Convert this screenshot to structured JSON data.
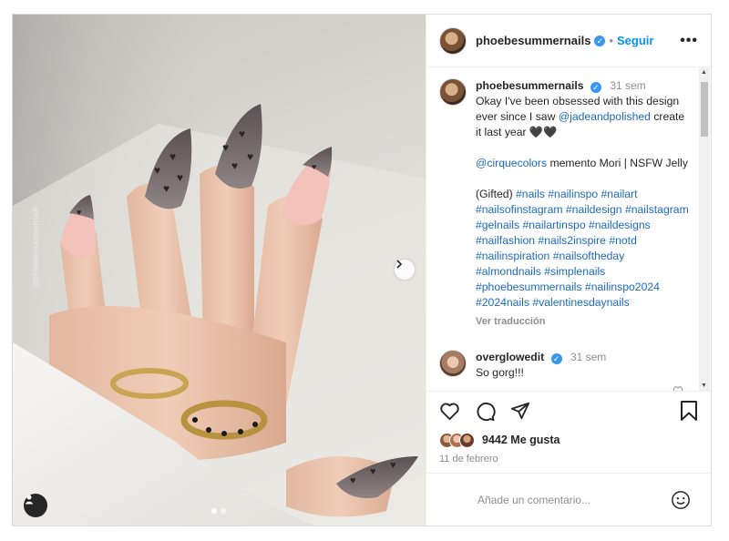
{
  "post": {
    "author": "phoebesummernails",
    "separator": "•",
    "follow_label": "Seguir",
    "more_label": "•••",
    "verified_glyph": "✓",
    "watermark": "@phoebesummernails",
    "icons": {
      "next": "chevron-right-icon",
      "user_tag": "user-icon",
      "like": "heart-icon",
      "comment": "comment-icon",
      "share": "send-icon",
      "save": "bookmark-icon",
      "emoji": "smiley-icon"
    }
  },
  "caption": {
    "author": "phoebesummernails",
    "time": "31 sem",
    "line1": "Okay I've been obsessed with this design ever since I saw",
    "mention1": "@jadeandpolished",
    "line1b": " create it last year 🖤🖤",
    "mention2": "@cirquecolors",
    "line2": " memento Mori | NSFW Jelly",
    "line3": "(Gifted)",
    "hashtags": "#nails #nailinspo #nailart #nailsofinstagram #naildesign #nailstagram #gelnails #nailartinspo #naildesigns #nailfashion #nails2inspire #notd #nailinspiration #nailsoftheday #almondnails #simplenails #phoebesummernails #nailinspo2024 #2024nails #valentinesdaynails",
    "translate": "Ver traducción"
  },
  "comment": {
    "author": "overglowedit",
    "time": "31 sem",
    "text": "So gorg!!!"
  },
  "likes": {
    "count_text": "9442 Me gusta",
    "date": "11 de febrero"
  },
  "compose": {
    "placeholder": "Añade un comentario..."
  },
  "colors": {
    "accent": "#0095f6",
    "verified": "#3897f0",
    "link": "#1c6ac2"
  },
  "carousel": {
    "slides": 2,
    "active": 1
  }
}
